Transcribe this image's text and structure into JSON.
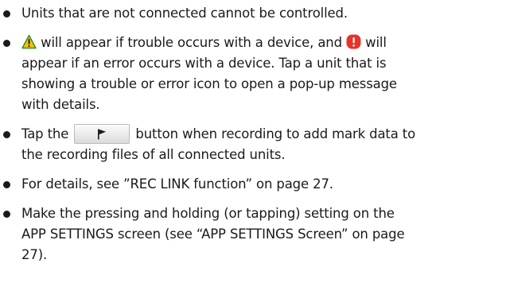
{
  "bullets": [
    {
      "lines": [
        "Units that are not connected cannot be controlled."
      ]
    },
    {
      "line1_after_warn": " will appear if trouble occurs with a device, and ",
      "line1_after_error": " will",
      "lines_rest": [
        "appear if an error occurs with a device. Tap a unit that is",
        "showing a trouble or error icon to open a pop-up message",
        "with details."
      ]
    },
    {
      "line1_before": "Tap the ",
      "line1_after": " button when recording to add mark data to",
      "lines_rest": [
        "the recording files of all connected units."
      ]
    },
    {
      "lines": [
        "For details, see ”REC LINK function” on page 27."
      ]
    },
    {
      "lines": [
        "Make the pressing and holding (or tapping) setting on the",
        "APP SETTINGS screen (see “APP SETTINGS Screen” on page",
        "27)."
      ]
    }
  ],
  "icons": {
    "warning": "warning-triangle-icon",
    "error": "error-exclamation-icon",
    "mark": "flag-icon"
  },
  "colors": {
    "warning_fill": "#f5c400",
    "warning_stroke": "#2e8b2e",
    "error_fill": "#e8332a",
    "text": "#1a1a1a"
  }
}
